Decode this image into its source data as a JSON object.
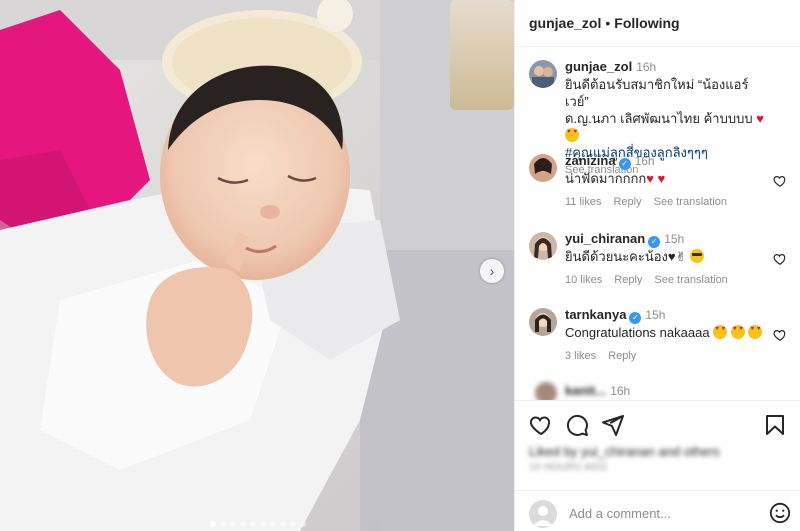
{
  "header": {
    "username": "gunjae_zol",
    "separator": "•",
    "follow_status": "Following"
  },
  "caption": {
    "username": "gunjae_zol",
    "time": "16h",
    "line1": "ยินดีต้อนรับสมาชิกใหม่ “น้องแอร์เวย์”",
    "line2": "ด.ญ.นภา เลิศพัฒนาไทย ค้าบบบบ",
    "hashtag": "#คุณแม่ลูกสี่ของลูกลิงๆๆๆ",
    "see_translation": "See translation"
  },
  "comments": [
    {
      "username": "zanizina",
      "verified": true,
      "time": "16h",
      "text": "น่าฟัดมากกกก",
      "likes": "11 likes",
      "reply": "Reply",
      "see_translation": "See translation"
    },
    {
      "username": "yui_chiranan",
      "verified": true,
      "time": "15h",
      "text": "ยินดีด้วยนะคะน้อง",
      "likes": "10 likes",
      "reply": "Reply",
      "see_translation": "See translation"
    },
    {
      "username": "tarnkanya",
      "verified": true,
      "time": "15h",
      "text": "Congratulations nakaaaa",
      "likes": "3 likes",
      "reply": "Reply"
    },
    {
      "username": "kanit...",
      "time": "16h"
    }
  ],
  "liked_by": "Liked by yui_chiranan and others",
  "posted_time": "16 HOURS AGO",
  "add_comment": {
    "placeholder": "Add a comment..."
  },
  "icons": {
    "like": "heart-icon",
    "comment": "comment-icon",
    "share": "share-icon",
    "save": "bookmark-icon",
    "emoji": "smiley-icon",
    "next": "chevron-right-icon"
  },
  "colors": {
    "verified": "#3897f0",
    "heart": "#e0162b",
    "hashtag": "#00376b",
    "muted": "#8e8e8e",
    "border": "#efefef"
  }
}
